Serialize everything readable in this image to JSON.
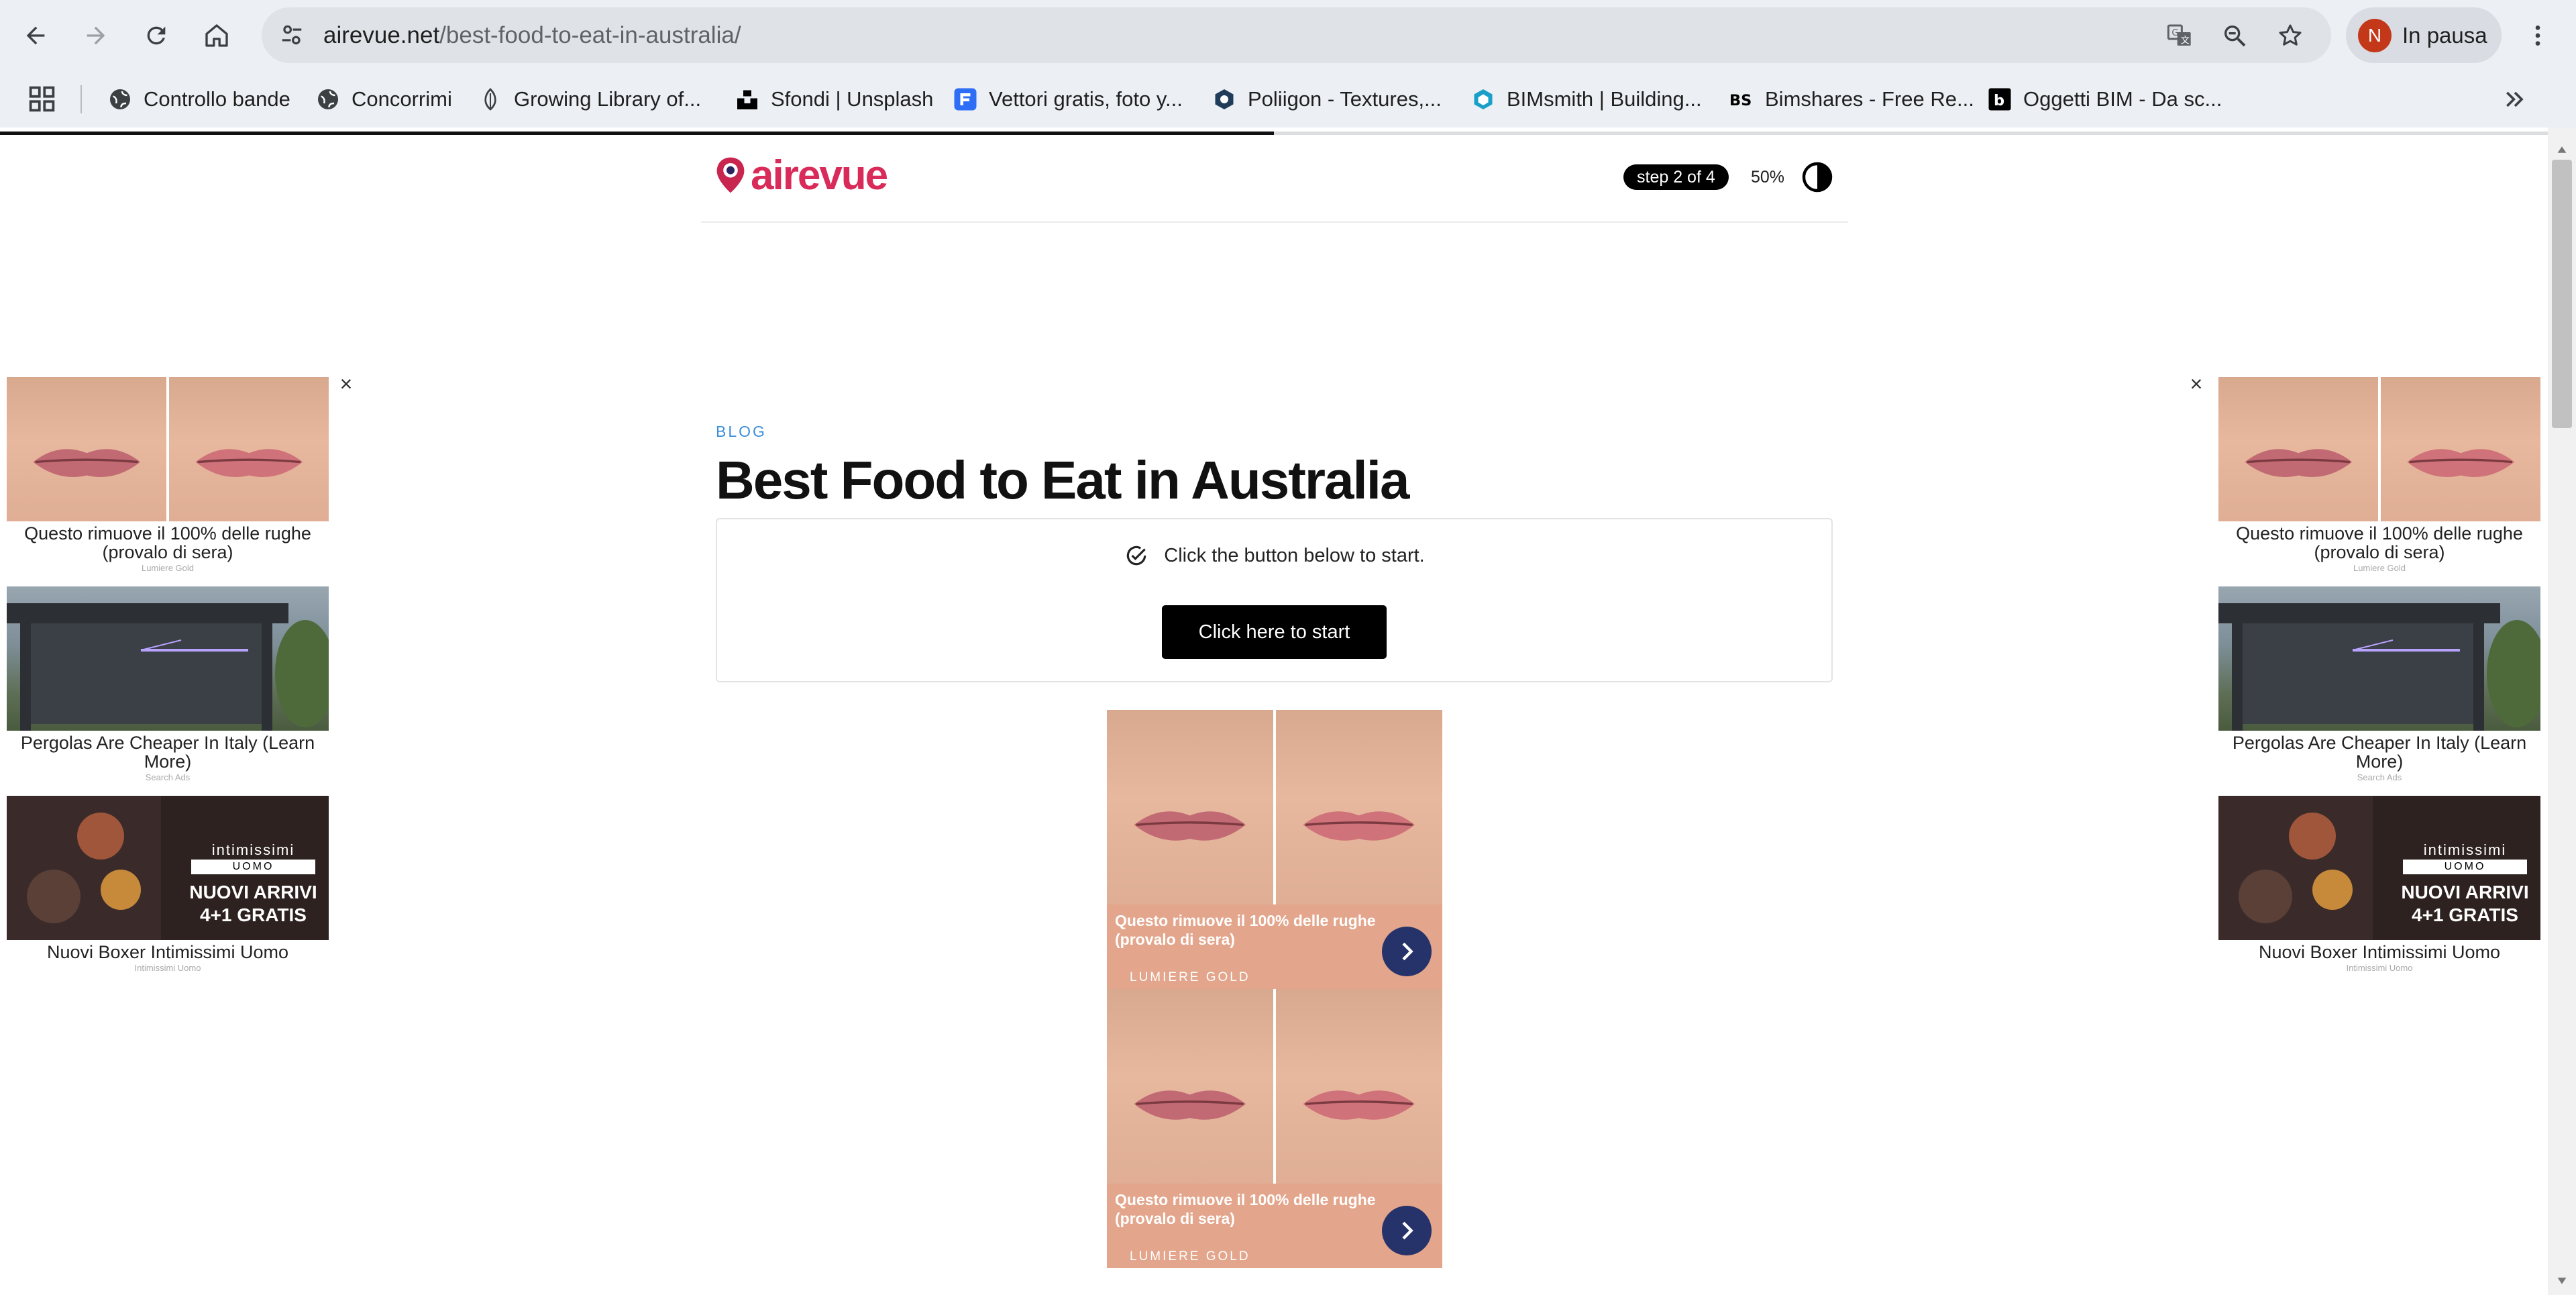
{
  "browser": {
    "url_host": "airevue.net",
    "url_path": "/best-food-to-eat-in-australia/",
    "profile_initial": "N",
    "profile_label": "In pausa",
    "bookmarks": [
      {
        "label": "Controllo bande",
        "icon": "globe-icon"
      },
      {
        "label": "Concorrimi",
        "icon": "globe-icon"
      },
      {
        "label": "Growing Library of...",
        "icon": "leaf-icon"
      },
      {
        "label": "Sfondi | Unsplash",
        "icon": "unsplash-icon"
      },
      {
        "label": "Vettori gratis, foto y...",
        "icon": "freepik-icon"
      },
      {
        "label": "Poliigon - Textures,...",
        "icon": "poliigon-icon"
      },
      {
        "label": "BIMsmith | Building...",
        "icon": "bimsmith-icon"
      },
      {
        "label": "Bimshares - Free Re...",
        "icon": "bimshares-icon"
      },
      {
        "label": "Oggetti BIM - Da sc...",
        "icon": "bim-objects-icon"
      }
    ]
  },
  "site": {
    "logo_text": "airevue",
    "step_badge": "step 2 of 4",
    "progress_percent": "50%",
    "progress_fraction": 0.5,
    "accent_color": "#d92b5a"
  },
  "article": {
    "kicker": "BLOG",
    "title": "Best Food to Eat in Australia",
    "start_hint": "Click the button below to start.",
    "start_button": "Click here to start"
  },
  "ads": {
    "side": [
      {
        "title": "Questo rimuove il 100% delle rughe (provalo di sera)",
        "source": "Lumiere Gold",
        "image": "lips"
      },
      {
        "title": "Pergolas Are Cheaper In Italy (Learn More)",
        "source": "Search Ads",
        "image": "pergola"
      },
      {
        "title": "Nuovi Boxer Intimissimi Uomo",
        "source": "Intimissimi Uomo",
        "image": "boxer"
      }
    ],
    "boxer_brand": "intimissimi",
    "boxer_sub": "UOMO",
    "boxer_promo_1": "NUOVI ARRIVI",
    "boxer_promo_2": "4+1 GRATIS",
    "center": [
      {
        "title": "Questo rimuove il 100% delle rughe (provalo di sera)",
        "brand": "LUMIERE GOLD"
      },
      {
        "title": "Questo rimuove il 100% delle rughe (provalo di sera)",
        "brand": "LUMIERE GOLD"
      }
    ]
  }
}
